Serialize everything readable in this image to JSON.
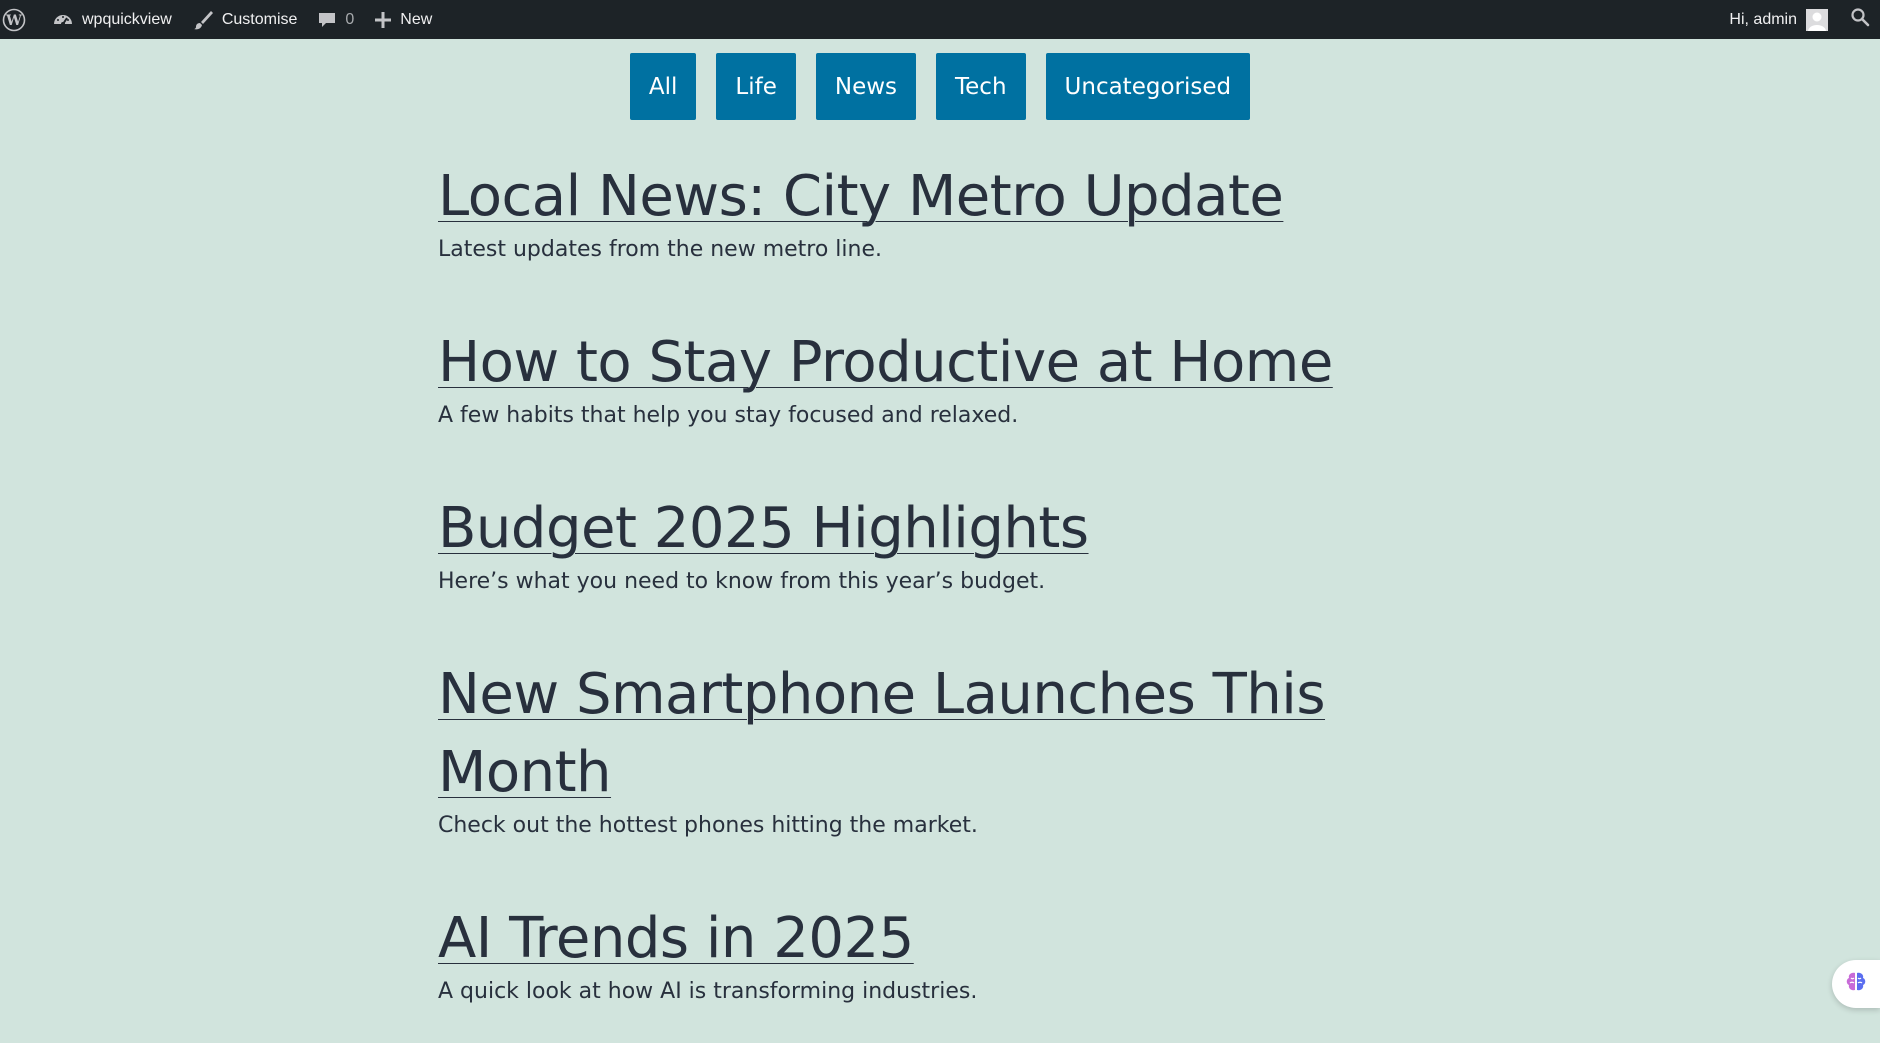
{
  "admin_bar": {
    "site_name": "wpquickview",
    "customise_label": "Customise",
    "comments_count": "0",
    "new_label": "New",
    "greeting": "Hi, admin"
  },
  "filters": [
    {
      "label": "All"
    },
    {
      "label": "Life"
    },
    {
      "label": "News"
    },
    {
      "label": "Tech"
    },
    {
      "label": "Uncategorised"
    }
  ],
  "posts": [
    {
      "title": "Local News: City Metro Update",
      "excerpt": "Latest updates from the new metro line."
    },
    {
      "title": "How to Stay Productive at Home",
      "excerpt": "A few habits that help you stay focused and relaxed."
    },
    {
      "title": "Budget 2025 Highlights",
      "excerpt": "Here’s what you need to know from this year’s budget."
    },
    {
      "title": "New Smartphone Launches This Month",
      "excerpt": "Check out the hottest phones hitting the market."
    },
    {
      "title": "AI Trends in 2025",
      "excerpt": "A quick look at how AI is transforming industries."
    }
  ],
  "colors": {
    "page_background": "#d1e4dd",
    "admin_bar_background": "#1d2327",
    "button_background": "#0071a1",
    "text": "#28303d"
  },
  "icons": {
    "wordpress": "wordpress-logo-icon",
    "site": "dashboard-icon",
    "customise": "brush-icon",
    "comments": "comment-bubble-icon",
    "new": "plus-icon",
    "avatar": "user-avatar-icon",
    "search": "search-icon",
    "widget": "brain-icon"
  }
}
